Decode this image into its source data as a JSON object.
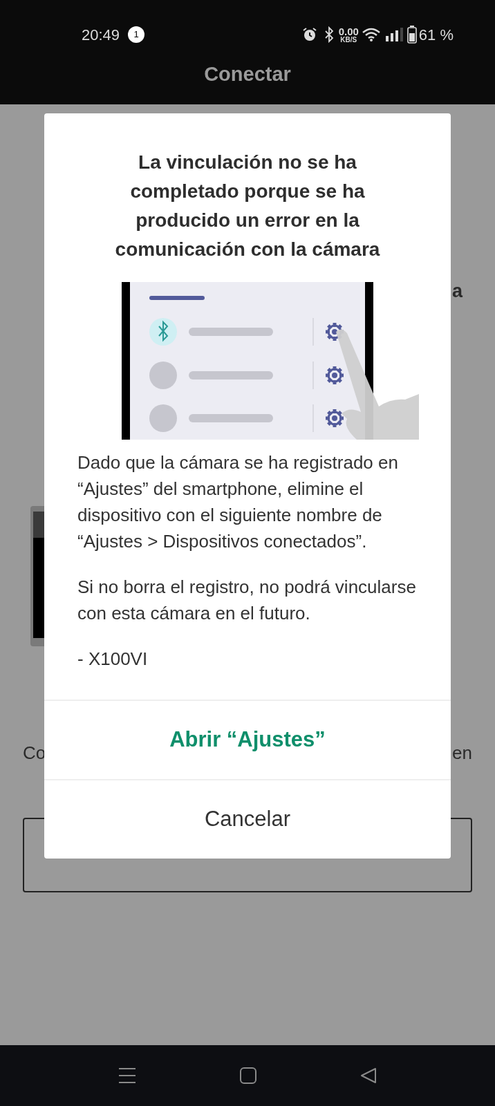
{
  "status_bar": {
    "time": "20:49",
    "notification_count": "1",
    "net_speed": "0.00",
    "net_unit": "KB/S",
    "battery": "61 %"
  },
  "app_bar": {
    "title": "Conectar"
  },
  "background": {
    "heading_fragments": [
      "a"
    ],
    "text_fragments": [
      "Co",
      "en"
    ]
  },
  "dialog": {
    "title": "La vinculación no se ha completado porque se ha producido un error en la comunicación con la cámara",
    "paragraphs": [
      "Dado que la cámara se ha registrado en “Ajustes” del smartphone, elimine el dispositivo con el siguiente nombre de “Ajustes > Dispositivos conectados”.",
      "Si no borra el registro, no podrá vincularse con esta cámara en el futuro.",
      "- X100VI"
    ],
    "buttons": [
      {
        "label": "Abrir “Ajustes”",
        "kind": "primary"
      },
      {
        "label": "Cancelar",
        "kind": "secondary"
      }
    ]
  }
}
